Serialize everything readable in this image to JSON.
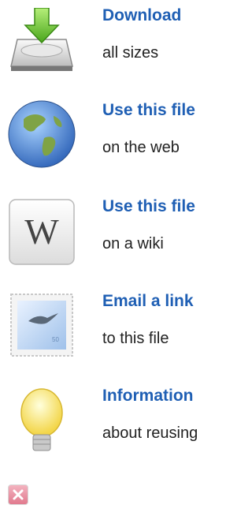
{
  "items": [
    {
      "title": "Download",
      "sub": "all sizes",
      "icon": "hard-drive-download-icon"
    },
    {
      "title": "Use this file",
      "sub": "on the web",
      "icon": "globe-icon"
    },
    {
      "title": "Use this file",
      "sub": "on a wiki",
      "icon": "wiki-w-icon"
    },
    {
      "title": "Email a link",
      "sub": "to this file",
      "icon": "stamp-icon"
    },
    {
      "title": "Information",
      "sub": "about reusing",
      "icon": "lightbulb-icon"
    }
  ],
  "colors": {
    "accent": "#1f5fb4",
    "text": "#222222"
  },
  "close_icon": "close-icon"
}
